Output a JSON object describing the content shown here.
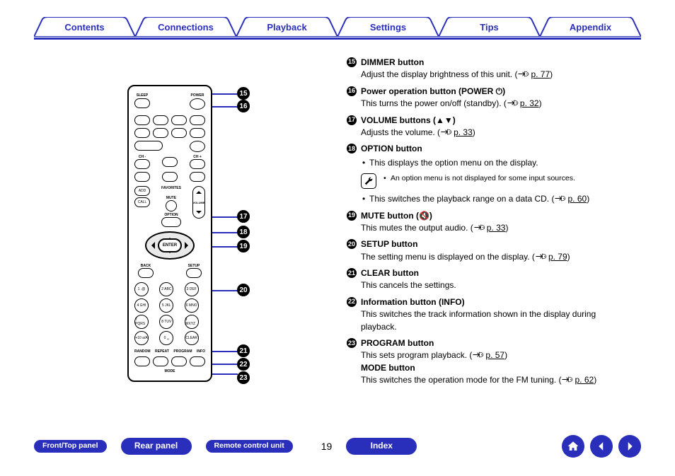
{
  "nav": {
    "tabs": [
      "Contents",
      "Connections",
      "Playback",
      "Settings",
      "Tips",
      "Appendix"
    ]
  },
  "callouts": {
    "c15": "15",
    "c16": "16",
    "c17": "17",
    "c18": "18",
    "c19": "19",
    "c20": "20",
    "c21": "21",
    "c22": "22",
    "c23": "23"
  },
  "remote": {
    "sleep": "SLEEP",
    "power": "POWER",
    "enter": "ENTER",
    "ch_up": "CH +",
    "ch_dn": "CH -",
    "add": "ADD",
    "call": "CALL",
    "favorites": "FAVORITES",
    "mute": "MUTE",
    "option": "OPTION",
    "volume": "VOLUME",
    "back": "BACK",
    "setup": "SETUP",
    "random": "RANDOM",
    "repeat": "REPEAT",
    "program": "PROGRAM",
    "info": "INFO",
    "mode": "MODE",
    "clear": "CLEAR",
    "num1": "1 .@",
    "num2": "2 ABC",
    "num3": "3 DEF",
    "num4": "4 GHI",
    "num5": "5 JKL",
    "num6": "6 MNO",
    "num7": "7 PQRS",
    "num8": "8 TUV",
    "num9": "9 WXYZ",
    "numplus": "+10 a/A",
    "num0": "0  ␣"
  },
  "items": [
    {
      "num": "15",
      "title": "DIMMER button",
      "descr": "Adjust the display brightness of this unit.",
      "page": "p. 77"
    },
    {
      "num": "16",
      "title": "Power operation button (POWER ⏻)",
      "descr": "This turns the power on/off (standby).",
      "page": "p. 32"
    },
    {
      "num": "17",
      "title": "VOLUME buttons (▲▼)",
      "descr": "Adjusts the volume.",
      "page": "p. 33"
    },
    {
      "num": "18",
      "title": "OPTION button",
      "bullet1": "This displays the option menu on the display.",
      "note": "An option menu is not displayed for some input sources.",
      "bullet2": "This switches the playback range on a data CD.",
      "page": "p. 60"
    },
    {
      "num": "19",
      "title": "MUTE button (🔇)",
      "descr": "This mutes the output audio.",
      "page": "p. 33"
    },
    {
      "num": "20",
      "title": "SETUP button",
      "descr": "The setting menu is displayed on the display.",
      "page": "p. 79"
    },
    {
      "num": "21",
      "title": "CLEAR button",
      "descr": "This cancels the settings."
    },
    {
      "num": "22",
      "title": "Information button (INFO)",
      "descr": "This switches the track information shown in the display during playback."
    },
    {
      "num": "23",
      "title": "PROGRAM button",
      "descr": "This sets program playback.",
      "page": "p. 57",
      "extra_title": "MODE button",
      "extra_descr": "This switches the operation mode for the FM tuning.",
      "extra_page": "p. 62"
    }
  ],
  "bottom": {
    "front": "Front/Top panel",
    "rear": "Rear panel",
    "remote": "Remote control unit",
    "page": "19",
    "index": "Index"
  }
}
